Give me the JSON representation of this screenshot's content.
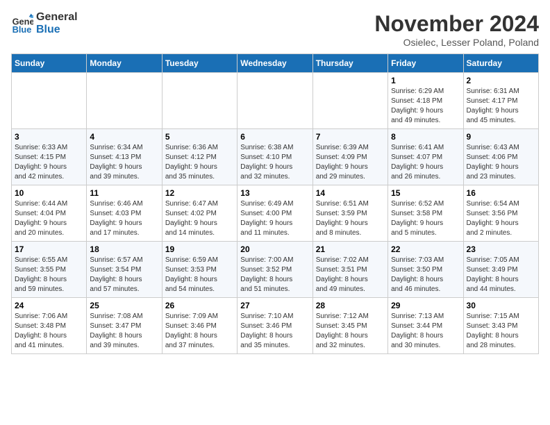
{
  "header": {
    "logo_line1": "General",
    "logo_line2": "Blue",
    "month_title": "November 2024",
    "location": "Osielec, Lesser Poland, Poland"
  },
  "weekdays": [
    "Sunday",
    "Monday",
    "Tuesday",
    "Wednesday",
    "Thursday",
    "Friday",
    "Saturday"
  ],
  "weeks": [
    [
      {
        "day": "",
        "info": ""
      },
      {
        "day": "",
        "info": ""
      },
      {
        "day": "",
        "info": ""
      },
      {
        "day": "",
        "info": ""
      },
      {
        "day": "",
        "info": ""
      },
      {
        "day": "1",
        "info": "Sunrise: 6:29 AM\nSunset: 4:18 PM\nDaylight: 9 hours\nand 49 minutes."
      },
      {
        "day": "2",
        "info": "Sunrise: 6:31 AM\nSunset: 4:17 PM\nDaylight: 9 hours\nand 45 minutes."
      }
    ],
    [
      {
        "day": "3",
        "info": "Sunrise: 6:33 AM\nSunset: 4:15 PM\nDaylight: 9 hours\nand 42 minutes."
      },
      {
        "day": "4",
        "info": "Sunrise: 6:34 AM\nSunset: 4:13 PM\nDaylight: 9 hours\nand 39 minutes."
      },
      {
        "day": "5",
        "info": "Sunrise: 6:36 AM\nSunset: 4:12 PM\nDaylight: 9 hours\nand 35 minutes."
      },
      {
        "day": "6",
        "info": "Sunrise: 6:38 AM\nSunset: 4:10 PM\nDaylight: 9 hours\nand 32 minutes."
      },
      {
        "day": "7",
        "info": "Sunrise: 6:39 AM\nSunset: 4:09 PM\nDaylight: 9 hours\nand 29 minutes."
      },
      {
        "day": "8",
        "info": "Sunrise: 6:41 AM\nSunset: 4:07 PM\nDaylight: 9 hours\nand 26 minutes."
      },
      {
        "day": "9",
        "info": "Sunrise: 6:43 AM\nSunset: 4:06 PM\nDaylight: 9 hours\nand 23 minutes."
      }
    ],
    [
      {
        "day": "10",
        "info": "Sunrise: 6:44 AM\nSunset: 4:04 PM\nDaylight: 9 hours\nand 20 minutes."
      },
      {
        "day": "11",
        "info": "Sunrise: 6:46 AM\nSunset: 4:03 PM\nDaylight: 9 hours\nand 17 minutes."
      },
      {
        "day": "12",
        "info": "Sunrise: 6:47 AM\nSunset: 4:02 PM\nDaylight: 9 hours\nand 14 minutes."
      },
      {
        "day": "13",
        "info": "Sunrise: 6:49 AM\nSunset: 4:00 PM\nDaylight: 9 hours\nand 11 minutes."
      },
      {
        "day": "14",
        "info": "Sunrise: 6:51 AM\nSunset: 3:59 PM\nDaylight: 9 hours\nand 8 minutes."
      },
      {
        "day": "15",
        "info": "Sunrise: 6:52 AM\nSunset: 3:58 PM\nDaylight: 9 hours\nand 5 minutes."
      },
      {
        "day": "16",
        "info": "Sunrise: 6:54 AM\nSunset: 3:56 PM\nDaylight: 9 hours\nand 2 minutes."
      }
    ],
    [
      {
        "day": "17",
        "info": "Sunrise: 6:55 AM\nSunset: 3:55 PM\nDaylight: 8 hours\nand 59 minutes."
      },
      {
        "day": "18",
        "info": "Sunrise: 6:57 AM\nSunset: 3:54 PM\nDaylight: 8 hours\nand 57 minutes."
      },
      {
        "day": "19",
        "info": "Sunrise: 6:59 AM\nSunset: 3:53 PM\nDaylight: 8 hours\nand 54 minutes."
      },
      {
        "day": "20",
        "info": "Sunrise: 7:00 AM\nSunset: 3:52 PM\nDaylight: 8 hours\nand 51 minutes."
      },
      {
        "day": "21",
        "info": "Sunrise: 7:02 AM\nSunset: 3:51 PM\nDaylight: 8 hours\nand 49 minutes."
      },
      {
        "day": "22",
        "info": "Sunrise: 7:03 AM\nSunset: 3:50 PM\nDaylight: 8 hours\nand 46 minutes."
      },
      {
        "day": "23",
        "info": "Sunrise: 7:05 AM\nSunset: 3:49 PM\nDaylight: 8 hours\nand 44 minutes."
      }
    ],
    [
      {
        "day": "24",
        "info": "Sunrise: 7:06 AM\nSunset: 3:48 PM\nDaylight: 8 hours\nand 41 minutes."
      },
      {
        "day": "25",
        "info": "Sunrise: 7:08 AM\nSunset: 3:47 PM\nDaylight: 8 hours\nand 39 minutes."
      },
      {
        "day": "26",
        "info": "Sunrise: 7:09 AM\nSunset: 3:46 PM\nDaylight: 8 hours\nand 37 minutes."
      },
      {
        "day": "27",
        "info": "Sunrise: 7:10 AM\nSunset: 3:46 PM\nDaylight: 8 hours\nand 35 minutes."
      },
      {
        "day": "28",
        "info": "Sunrise: 7:12 AM\nSunset: 3:45 PM\nDaylight: 8 hours\nand 32 minutes."
      },
      {
        "day": "29",
        "info": "Sunrise: 7:13 AM\nSunset: 3:44 PM\nDaylight: 8 hours\nand 30 minutes."
      },
      {
        "day": "30",
        "info": "Sunrise: 7:15 AM\nSunset: 3:43 PM\nDaylight: 8 hours\nand 28 minutes."
      }
    ]
  ]
}
